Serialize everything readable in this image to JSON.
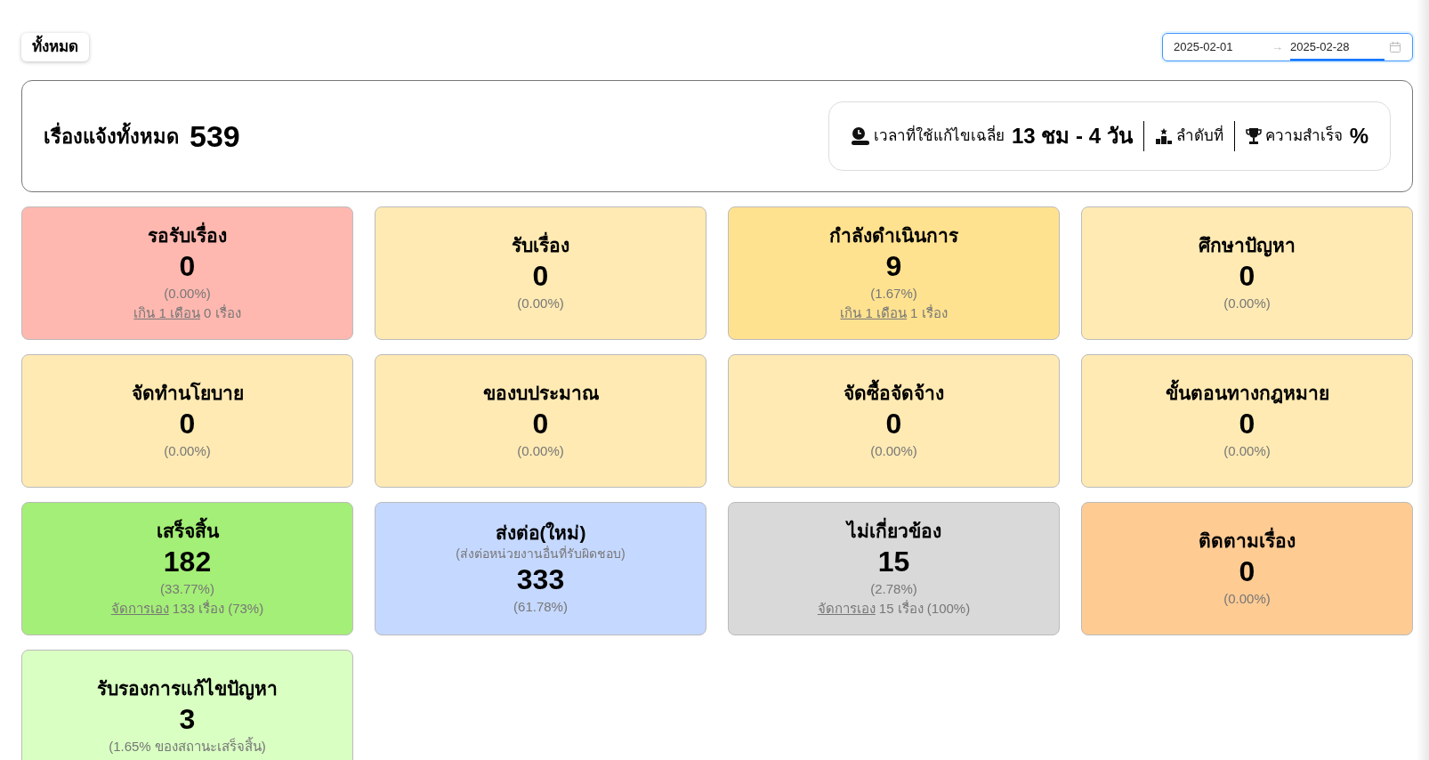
{
  "filter_button": "ทั้งหมด",
  "date_range": {
    "start": "2025-02-01",
    "separator": "→",
    "end": "2025-02-28"
  },
  "summary": {
    "label": "เรื่องแจ้งทั้งหมด",
    "total": "539",
    "stats": [
      {
        "kind": "time",
        "label": "เวลาที่ใช้แก้ไขเฉลี่ย",
        "value": "13 ชม - 4 วัน"
      },
      {
        "kind": "rank",
        "label": "ลำดับที่"
      },
      {
        "kind": "success",
        "label": "ความสำเร็จ",
        "value": "%"
      }
    ]
  },
  "cards": [
    {
      "title": "รอรับเรื่อง",
      "count": "0",
      "percent": "(0.00%)",
      "color": "#ffb8b0",
      "note": {
        "link": "เกิน 1 เดือน",
        "text": "0 เรื่อง"
      }
    },
    {
      "title": "รับเรื่อง",
      "count": "0",
      "percent": "(0.00%)",
      "color": "#ffeab3"
    },
    {
      "title": "กำลังดำเนินการ",
      "count": "9",
      "percent": "(1.67%)",
      "color": "#ffe28f",
      "note": {
        "link": "เกิน 1 เดือน",
        "text": "1 เรื่อง"
      }
    },
    {
      "title": "ศึกษาปัญหา",
      "count": "0",
      "percent": "(0.00%)",
      "color": "#ffeab3"
    },
    {
      "title": "จัดทำนโยบาย",
      "count": "0",
      "percent": "(0.00%)",
      "color": "#ffeab3"
    },
    {
      "title": "ของบประมาณ",
      "count": "0",
      "percent": "(0.00%)",
      "color": "#ffeab3"
    },
    {
      "title": "จัดซื้อจัดจ้าง",
      "count": "0",
      "percent": "(0.00%)",
      "color": "#ffeab3"
    },
    {
      "title": "ขั้นตอนทางกฎหมาย",
      "count": "0",
      "percent": "(0.00%)",
      "color": "#ffeab3"
    },
    {
      "title": "เสร็จสิ้น",
      "count": "182",
      "percent": "(33.77%)",
      "color": "#a4ef77",
      "note": {
        "link": "จัดการเอง",
        "text": "133 เรื่อง (73%)"
      }
    },
    {
      "title": "ส่งต่อ(ใหม่)",
      "subtitle": "(ส่งต่อหน่วยงานอื่นที่รับผิดชอบ)",
      "count": "333",
      "percent": "(61.78%)",
      "color": "#c5d8ff"
    },
    {
      "title": "ไม่เกี่ยวข้อง",
      "count": "15",
      "percent": "(2.78%)",
      "color": "#d9d9d9",
      "note": {
        "link": "จัดการเอง",
        "text": "15 เรื่อง (100%)"
      }
    },
    {
      "title": "ติดตามเรื่อง",
      "count": "0",
      "percent": "(0.00%)",
      "color": "#fecb93"
    },
    {
      "title": "รับรองการแก้ไขปัญหา",
      "count": "3",
      "percent": "(1.65% ของสถานะเสร็จสิ้น)",
      "color": "#d9ffc2"
    }
  ]
}
